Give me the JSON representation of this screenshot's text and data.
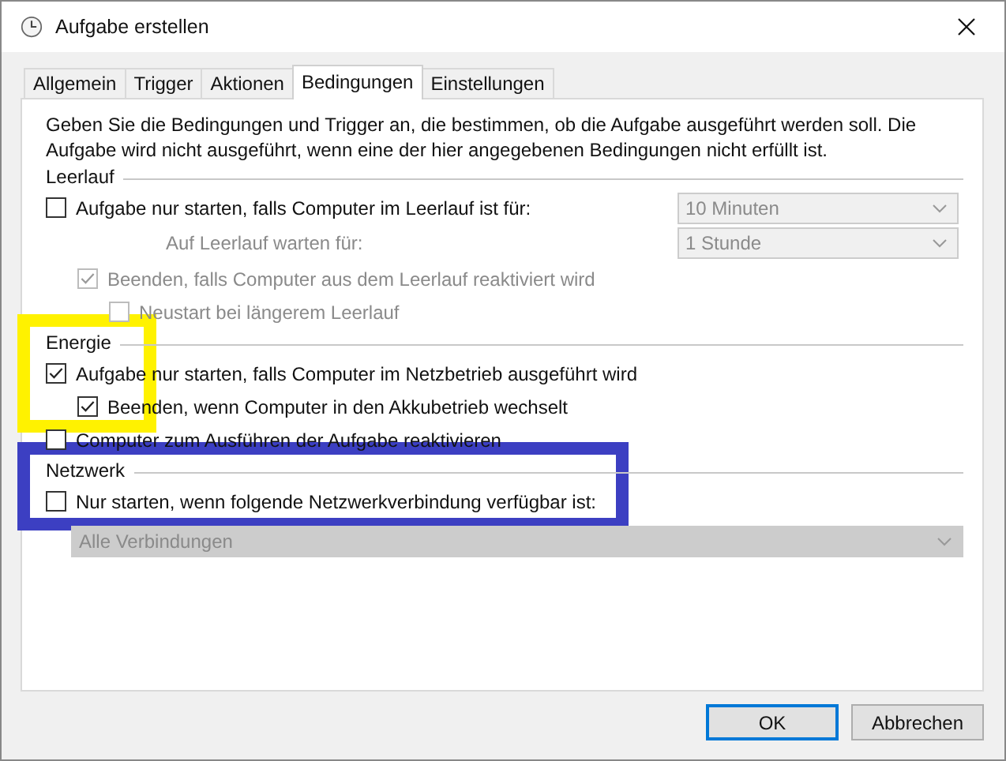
{
  "window": {
    "title": "Aufgabe erstellen"
  },
  "tabs": [
    {
      "label": "Allgemein",
      "selected": false
    },
    {
      "label": "Trigger",
      "selected": false
    },
    {
      "label": "Aktionen",
      "selected": false
    },
    {
      "label": "Bedingungen",
      "selected": true
    },
    {
      "label": "Einstellungen",
      "selected": false
    }
  ],
  "description": "Geben Sie die Bedingungen und Trigger an, die bestimmen, ob die Aufgabe ausgeführt werden soll. Die Aufgabe wird nicht ausgeführt, wenn eine der hier angegebenen Bedingungen nicht erfüllt ist.",
  "sections": [
    {
      "title": "Leerlauf",
      "items": [
        {
          "kind": "checkbox",
          "label": "Aufgabe nur starten, falls Computer im Leerlauf ist für:",
          "checked": false,
          "disabled": false,
          "select": {
            "value": "10 Minuten",
            "disabled": true
          },
          "children": [
            {
              "kind": "label",
              "label": "Auf Leerlauf warten für:",
              "disabled": true,
              "select": {
                "value": "1 Stunde",
                "disabled": true
              }
            },
            {
              "kind": "checkbox",
              "label": "Beenden, falls Computer aus dem Leerlauf reaktiviert wird",
              "checked": true,
              "disabled": true,
              "children": [
                {
                  "kind": "checkbox",
                  "label": "Neustart bei längerem Leerlauf",
                  "checked": false,
                  "disabled": true
                }
              ]
            }
          ]
        }
      ]
    },
    {
      "title": "Energie",
      "highlight": {
        "color": "#fff200"
      },
      "items": [
        {
          "kind": "checkbox",
          "label": "Aufgabe nur starten, falls Computer im Netzbetrieb ausgeführt wird",
          "checked": true,
          "disabled": false,
          "children": [
            {
              "kind": "checkbox",
              "label": "Beenden, wenn Computer in den Akkubetrieb wechselt",
              "checked": true,
              "disabled": false
            }
          ]
        },
        {
          "kind": "checkbox",
          "label": "Computer zum Ausführen der Aufgabe reaktivieren",
          "checked": false,
          "disabled": false
        }
      ]
    },
    {
      "title": "Netzwerk",
      "highlight": {
        "color": "#3c3fc2"
      },
      "items": [
        {
          "kind": "checkbox",
          "label": "Nur starten, wenn folgende Netzwerkverbindung verfügbar ist:",
          "checked": false,
          "disabled": false
        },
        {
          "kind": "select",
          "value": "Alle Verbindungen",
          "disabled": true
        }
      ]
    }
  ],
  "buttons": [
    {
      "label": "OK",
      "default": true
    },
    {
      "label": "Abbrechen",
      "default": false
    }
  ]
}
